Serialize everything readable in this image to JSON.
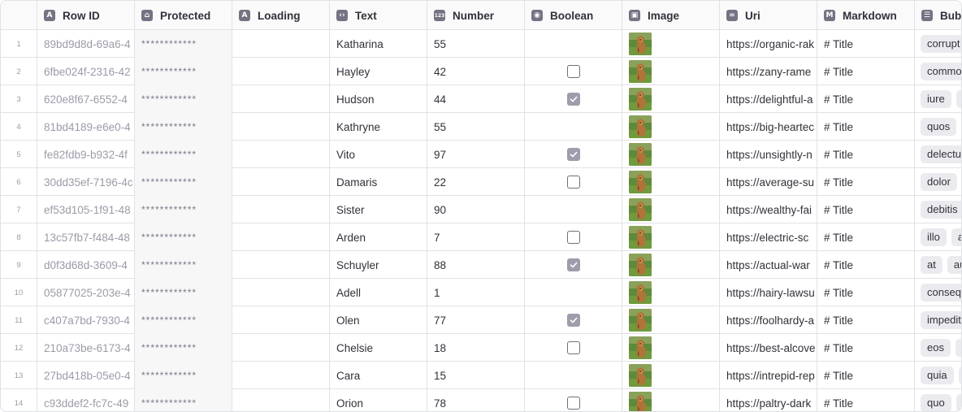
{
  "columns": [
    {
      "label": "Row ID",
      "icon": "A",
      "name": "rowid"
    },
    {
      "label": "Protected",
      "icon": "⌂",
      "name": "protected"
    },
    {
      "label": "Loading",
      "icon": "A",
      "name": "loading"
    },
    {
      "label": "Text",
      "icon": "‹›",
      "name": "text"
    },
    {
      "label": "Number",
      "icon": "123",
      "name": "number"
    },
    {
      "label": "Boolean",
      "icon": "◉",
      "name": "boolean"
    },
    {
      "label": "Image",
      "icon": "▣",
      "name": "image"
    },
    {
      "label": "Uri",
      "icon": "∞",
      "name": "uri"
    },
    {
      "label": "Markdown",
      "icon": "M",
      "name": "markdown"
    },
    {
      "label": "Bubble",
      "icon": "☰",
      "name": "bubble"
    }
  ],
  "rows": [
    {
      "num": "1",
      "rowid": "89bd9d8d-69a6-4",
      "protected": "************",
      "text": "Katharina",
      "number": "55",
      "boolean": "indeterminate",
      "uri": "https://organic-rak",
      "markdown": "# Title",
      "bubbles": [
        "corrupt"
      ]
    },
    {
      "num": "2",
      "rowid": "6fbe024f-2316-42",
      "protected": "************",
      "text": "Hayley",
      "number": "42",
      "boolean": "unchecked",
      "uri": "https://zany-rame",
      "markdown": "# Title",
      "bubbles": [
        "commo"
      ]
    },
    {
      "num": "3",
      "rowid": "620e8f67-6552-4",
      "protected": "************",
      "text": "Hudson",
      "number": "44",
      "boolean": "checked",
      "uri": "https://delightful-a",
      "markdown": "# Title",
      "bubbles": [
        "iure",
        "e"
      ]
    },
    {
      "num": "4",
      "rowid": "81bd4189-e6e0-4",
      "protected": "************",
      "text": "Kathryne",
      "number": "55",
      "boolean": "indeterminate",
      "uri": "https://big-heartec",
      "markdown": "# Title",
      "bubbles": [
        "quos",
        "c"
      ]
    },
    {
      "num": "5",
      "rowid": "fe82fdb9-b932-4f",
      "protected": "************",
      "text": "Vito",
      "number": "97",
      "boolean": "checked",
      "uri": "https://unsightly-n",
      "markdown": "# Title",
      "bubbles": [
        "delectu"
      ]
    },
    {
      "num": "6",
      "rowid": "30dd35ef-7196-4c",
      "protected": "************",
      "text": "Damaris",
      "number": "22",
      "boolean": "unchecked",
      "uri": "https://average-su",
      "markdown": "# Title",
      "bubbles": [
        "dolor",
        "c"
      ]
    },
    {
      "num": "7",
      "rowid": "ef53d105-1f91-48",
      "protected": "************",
      "text": "Sister",
      "number": "90",
      "boolean": "indeterminate",
      "uri": "https://wealthy-fai",
      "markdown": "# Title",
      "bubbles": [
        "debitis"
      ]
    },
    {
      "num": "8",
      "rowid": "13c57fb7-f484-48",
      "protected": "************",
      "text": "Arden",
      "number": "7",
      "boolean": "unchecked",
      "uri": "https://electric-sc",
      "markdown": "# Title",
      "bubbles": [
        "illo",
        "a"
      ]
    },
    {
      "num": "9",
      "rowid": "d0f3d68d-3609-4",
      "protected": "************",
      "text": "Schuyler",
      "number": "88",
      "boolean": "checked",
      "uri": "https://actual-war",
      "markdown": "# Title",
      "bubbles": [
        "at",
        "au"
      ]
    },
    {
      "num": "10",
      "rowid": "05877025-203e-4",
      "protected": "************",
      "text": "Adell",
      "number": "1",
      "boolean": "indeterminate",
      "uri": "https://hairy-lawsu",
      "markdown": "# Title",
      "bubbles": [
        "conseq"
      ]
    },
    {
      "num": "11",
      "rowid": "c407a7bd-7930-4",
      "protected": "************",
      "text": "Olen",
      "number": "77",
      "boolean": "checked",
      "uri": "https://foolhardy-a",
      "markdown": "# Title",
      "bubbles": [
        "impedit"
      ]
    },
    {
      "num": "12",
      "rowid": "210a73be-6173-4",
      "protected": "************",
      "text": "Chelsie",
      "number": "18",
      "boolean": "unchecked",
      "uri": "https://best-alcove",
      "markdown": "# Title",
      "bubbles": [
        "eos",
        "a"
      ]
    },
    {
      "num": "13",
      "rowid": "27bd418b-05e0-4",
      "protected": "************",
      "text": "Cara",
      "number": "15",
      "boolean": "indeterminate",
      "uri": "https://intrepid-rep",
      "markdown": "# Title",
      "bubbles": [
        "quia",
        "c"
      ]
    },
    {
      "num": "14",
      "rowid": "c93ddef2-fc7c-49",
      "protected": "************",
      "text": "Orion",
      "number": "78",
      "boolean": "unchecked",
      "uri": "https://paltry-dark",
      "markdown": "# Title",
      "bubbles": [
        "quo",
        "e"
      ]
    }
  ]
}
